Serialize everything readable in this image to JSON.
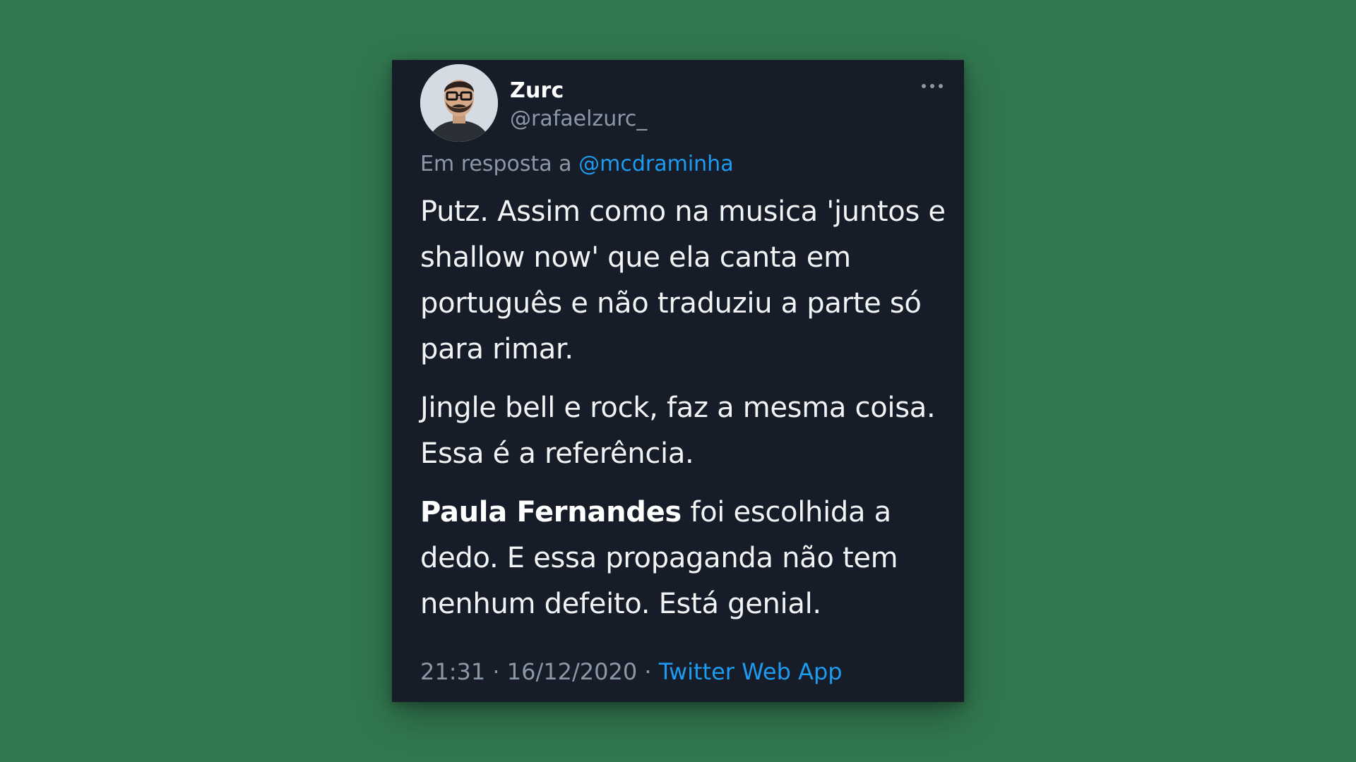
{
  "colors": {
    "background": "#32784f",
    "card": "#161d28",
    "text": "#f1f3f5",
    "muted": "#8b98a5",
    "link": "#1d9bf0"
  },
  "author": {
    "name": "Zurc",
    "handle": "@rafaelzurc_",
    "avatar_icon": "profile-photo"
  },
  "more_icon": "more-horizontal-icon",
  "reply": {
    "prefix": "Em resposta a",
    "mention": "@mcdraminha"
  },
  "tweet": {
    "p1": "Putz. Assim como na musica 'juntos e shallow now' que ela canta em português e não traduziu a parte só para rimar.",
    "p2": "Jingle bell e rock, faz a mesma coisa. Essa é a referência.",
    "p3_bold": "Paula Fernandes",
    "p3_rest": " foi escolhida a dedo. E essa propaganda não tem nenhum defeito. Está genial."
  },
  "meta": {
    "time": "21:31",
    "separator1": " · ",
    "date": "16/12/2020",
    "separator2": " · ",
    "source": "Twitter Web App"
  }
}
